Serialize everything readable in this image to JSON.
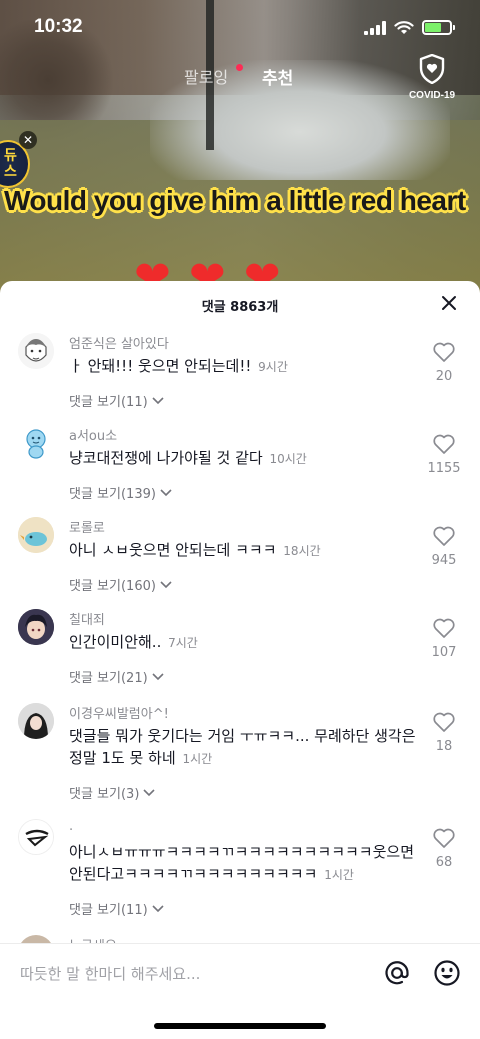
{
  "status": {
    "time": "10:32"
  },
  "feed": {
    "tab_following": "팔로잉",
    "tab_for_you": "추천",
    "covid_label": "COVID-19",
    "caption": "Would you give him a little red heart",
    "sticker_text": "듀스"
  },
  "comments_sheet": {
    "title": "댓글 8863개",
    "comments": [
      {
        "user": "엄준식은 살아있다",
        "text": "ㅏ 안돼!!! 웃으면 안되는데!!",
        "time": "9시간",
        "replies": "댓글 보기(11)",
        "likes": "20"
      },
      {
        "user": "a서ou소",
        "text": "냥코대전쟁에 나가야될 것 같다",
        "time": "10시간",
        "replies": "댓글 보기(139)",
        "likes": "1155"
      },
      {
        "user": "로롤로",
        "text": "아니 ㅅㅂ웃으면 안되는데 ㅋㅋㅋ",
        "time": "18시간",
        "replies": "댓글 보기(160)",
        "likes": "945"
      },
      {
        "user": "칠대죄",
        "text": "인간이미안해..",
        "time": "7시간",
        "replies": "댓글 보기(21)",
        "likes": "107"
      },
      {
        "user": "이경우씨발럼아^!",
        "text": "댓글들 뭐가 웃기다는 거임 ㅜㅠㅋㅋ... 무례하단 생각은 정말 1도 못 하네",
        "time": "1시간",
        "replies": "댓글 보기(3)",
        "likes": "18"
      },
      {
        "user": ".",
        "text": "아니ㅅㅂㅠㅠㅠㅋㅋㅋㅋㄲㅋㅋㅋㅋㅋㅋㅋㅋㅋㅋ웃으면 안된다고ㅋㅋㅋㅋㄲㅋㅋㅋㅋㅋㅋㅋㅋㅋ",
        "time": "1시간",
        "replies": "댓글 보기(11)",
        "likes": "68"
      },
      {
        "user": "누구세요"
      }
    ],
    "input_placeholder": "따듯한 말 한마디 해주세요..."
  },
  "colors": {
    "accent": "#fe2c55",
    "heart": "#ef2b2b",
    "caption_outline": "#ffe14a"
  }
}
